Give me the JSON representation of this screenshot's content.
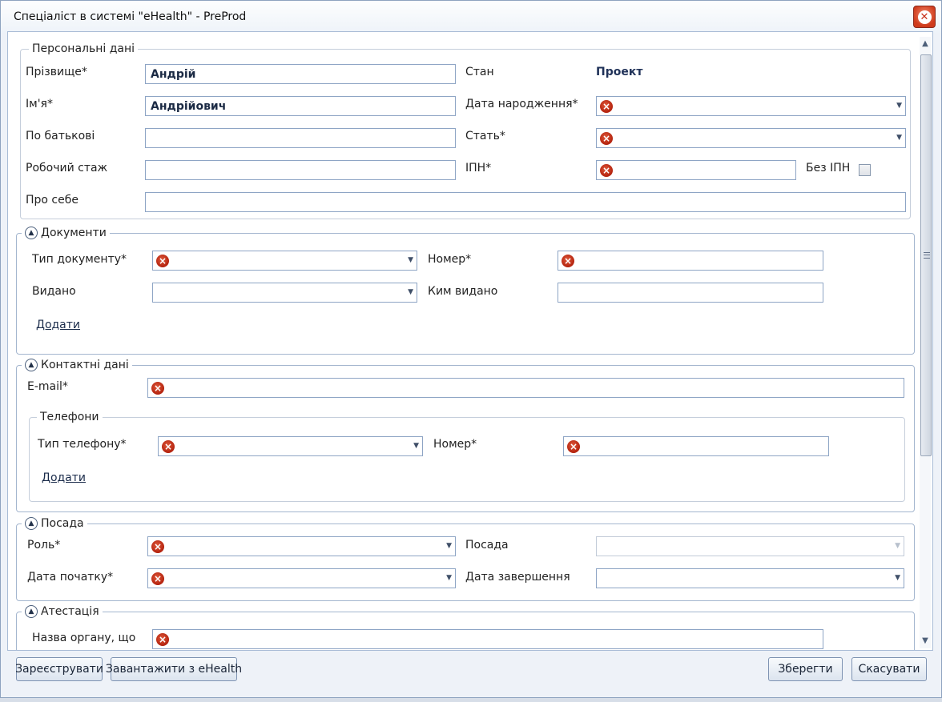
{
  "window": {
    "title": "Спеціаліст в системі \"eHealth\" - PreProd"
  },
  "personal": {
    "legend": "Персональні дані",
    "last_name_label": "Прізвище*",
    "last_name_value": "Андрій",
    "first_name_label": "Ім'я*",
    "first_name_value": "Андрійович",
    "patronymic_label": "По батькові",
    "patronymic_value": "",
    "experience_label": "Робочий стаж",
    "experience_value": "",
    "about_label": "Про себе",
    "about_value": "",
    "status_label": "Стан",
    "status_value": "Проект",
    "birth_label": "Дата народження*",
    "gender_label": "Стать*",
    "tax_label": "ІПН*",
    "no_tax_label": "Без ІПН"
  },
  "documents": {
    "legend": "Документи",
    "type_label": "Тип документу*",
    "number_label": "Номер*",
    "issued_label": "Видано",
    "issued_by_label": "Ким видано",
    "add_link": "Додати"
  },
  "contacts": {
    "legend": "Контактні дані",
    "email_label": "E-mail*",
    "phones_legend": "Телефони",
    "phone_type_label": "Тип телефону*",
    "phone_number_label": "Номер*",
    "add_link": "Додати"
  },
  "position": {
    "legend": "Посада",
    "role_label": "Роль*",
    "position_label": "Посада",
    "start_label": "Дата початку*",
    "end_label": "Дата завершення"
  },
  "attestation": {
    "legend": "Атестація",
    "org_label": "Назва органу, що"
  },
  "footer": {
    "register": "Зареєструвати",
    "load": "Завантажити з eHealth",
    "save": "Зберегти",
    "cancel": "Скасувати"
  },
  "icons": {
    "error": "error-icon",
    "collapse": "collapse-icon",
    "close": "close-icon"
  }
}
